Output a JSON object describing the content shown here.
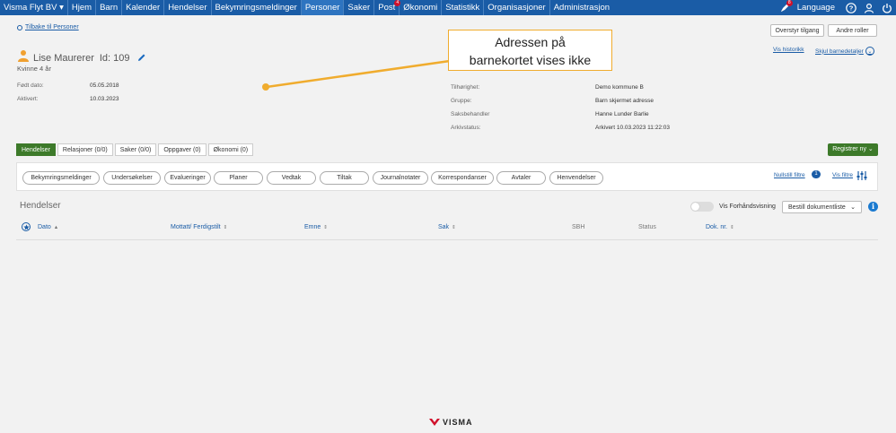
{
  "nav": {
    "items": [
      {
        "label": "Visma Flyt BV",
        "chevron": "▾"
      },
      {
        "label": "Hjem"
      },
      {
        "label": "Barn"
      },
      {
        "label": "Kalender"
      },
      {
        "label": "Hendelser"
      },
      {
        "label": "Bekymringsmeldinger"
      },
      {
        "label": "Personer",
        "active": true
      },
      {
        "label": "Saker"
      },
      {
        "label": "Post",
        "badge": "4"
      },
      {
        "label": "Økonomi"
      },
      {
        "label": "Statistikk"
      },
      {
        "label": "Organisasjoner"
      },
      {
        "label": "Administrasjon"
      }
    ],
    "rocket_badge": "8",
    "language": "Language"
  },
  "back_link": "Tilbake til Personer",
  "buttons": {
    "overstyr": "Overstyr tilgang",
    "andre_roller": "Andre roller",
    "vis_historikk": "Vis historikk",
    "skjul": "Skjul barnedetaljer"
  },
  "person": {
    "name": "Lise Maurerer",
    "id": "Id: 109",
    "subtitle": "Kvinne 4 år"
  },
  "left_fields": [
    {
      "label": "Født dato:",
      "value": "05.05.2018"
    },
    {
      "label": "Aktivert:",
      "value": "10.03.2023"
    }
  ],
  "right_fields": [
    {
      "label": "Tilhørighet:",
      "value": "Demo kommune B"
    },
    {
      "label": "Gruppe:",
      "value": "Barn skjermet adresse"
    },
    {
      "label": "Saksbehandler",
      "value": "Hanne Lunder Barlie"
    },
    {
      "label": "Arkivstatus:",
      "value": "Arkivert 10.03.2023 11:22:03"
    }
  ],
  "callout": {
    "line1": "Adressen på",
    "line2": "barnekortet vises ikke"
  },
  "tabs": [
    {
      "label": "Hendelser",
      "active": true
    },
    {
      "label": "Relasjoner (0/0)"
    },
    {
      "label": "Saker (0/0)"
    },
    {
      "label": "Oppgaver (0)"
    },
    {
      "label": "Økonomi (0)"
    }
  ],
  "registrer": "Registrer ny",
  "filters": {
    "pills": [
      "Bekymringsmeldinger",
      "Undersøkelser",
      "Evalueringer",
      "Planer",
      "Vedtak",
      "Tiltak",
      "Journalnotater",
      "Korrespondanser",
      "Avtaler",
      "Henvendelser"
    ],
    "nullstill": "Nullstill filtre",
    "nullstill_count": "1",
    "vis_filtre": "Vis filtre"
  },
  "hendelser": {
    "title": "Hendelser",
    "toggle_label": "Vis Forhåndsvisning",
    "bestill": "Bestill dokumentliste",
    "columns": [
      "Dato",
      "Mottatt/ Ferdigstilt",
      "Emne",
      "Sak",
      "SBH",
      "Status",
      "Dok. nr."
    ]
  },
  "footer": {
    "brand": "VISMA"
  },
  "colors": {
    "nav": "#1a5ca6",
    "primary_green": "#3d7a2a",
    "callout_border": "#f0ac2e",
    "link": "#1a5ca6"
  }
}
